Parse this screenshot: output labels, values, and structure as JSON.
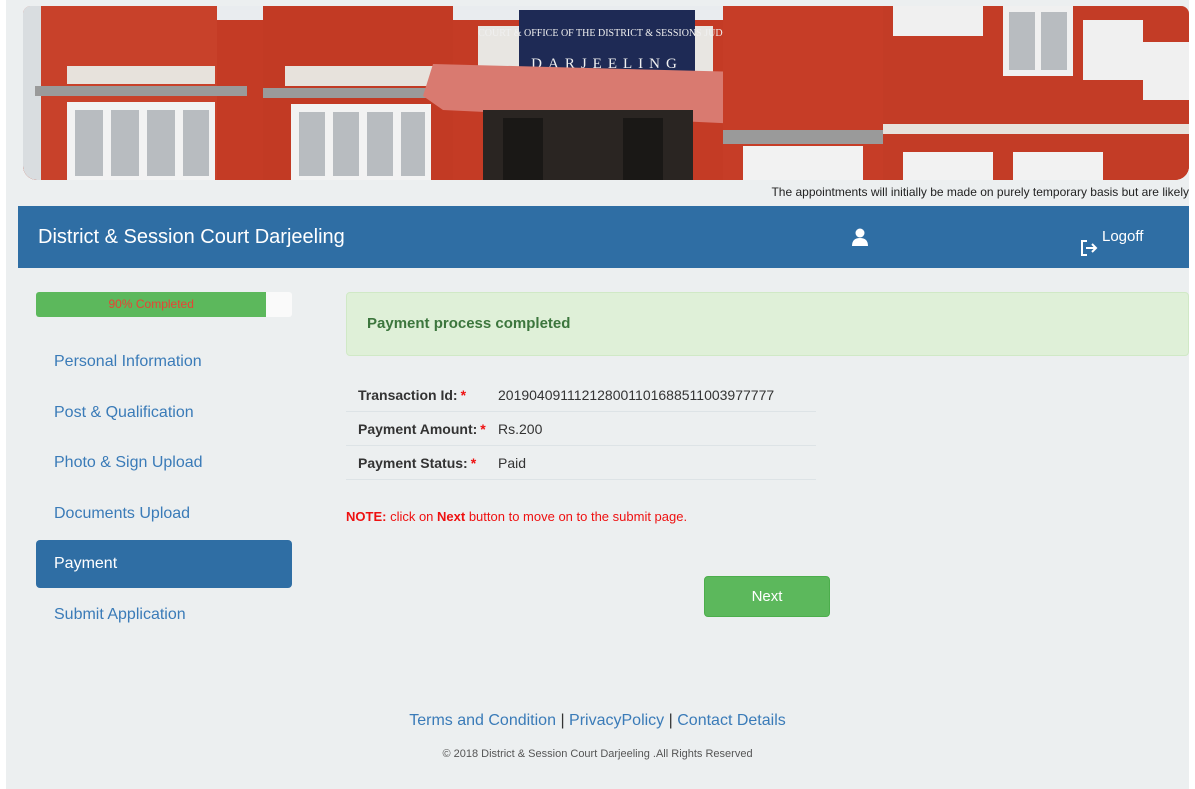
{
  "banner": {
    "sign_line1": "COURT & OFFICE OF THE DISTRICT & SESSIONS JUDGE",
    "sign_line2": "DARJEELING",
    "marquee_text": "The appointments will initially be made on purely temporary basis but are likely"
  },
  "header": {
    "title": "District & Session Court Darjeeling",
    "logoff_label": "Logoff"
  },
  "progress": {
    "label": "90% Completed",
    "percent": 90
  },
  "sidebar": {
    "items": [
      {
        "label": "Personal Information"
      },
      {
        "label": "Post & Qualification"
      },
      {
        "label": "Photo & Sign Upload"
      },
      {
        "label": "Documents Upload"
      },
      {
        "label": "Payment"
      },
      {
        "label": "Submit Application"
      }
    ],
    "active_index": 4
  },
  "main": {
    "alert": "Payment process completed",
    "details": [
      {
        "label": "Transaction Id:",
        "required_mark": "*",
        "value": "201904091112128001101688511003977777"
      },
      {
        "label": "Payment Amount:",
        "required_mark": "*",
        "value": "Rs.200"
      },
      {
        "label": "Payment Status:",
        "required_mark": "*",
        "value": "Paid"
      }
    ],
    "note": {
      "prefix": "NOTE:",
      "text1": " click on ",
      "bold": "Next",
      "text2": " button to move on to the submit page."
    },
    "next_label": "Next"
  },
  "footer": {
    "link_terms": "Terms and Condition",
    "link_privacy": "PrivacyPolicy",
    "link_contact": "Contact Details",
    "separator": "|",
    "copyright": "© 2018 District & Session Court Darjeeling .All Rights Reserved"
  },
  "colors": {
    "primary": "#2f6ea4",
    "success": "#5cb85c",
    "link": "#3a7bb8",
    "danger": "#e11111"
  }
}
